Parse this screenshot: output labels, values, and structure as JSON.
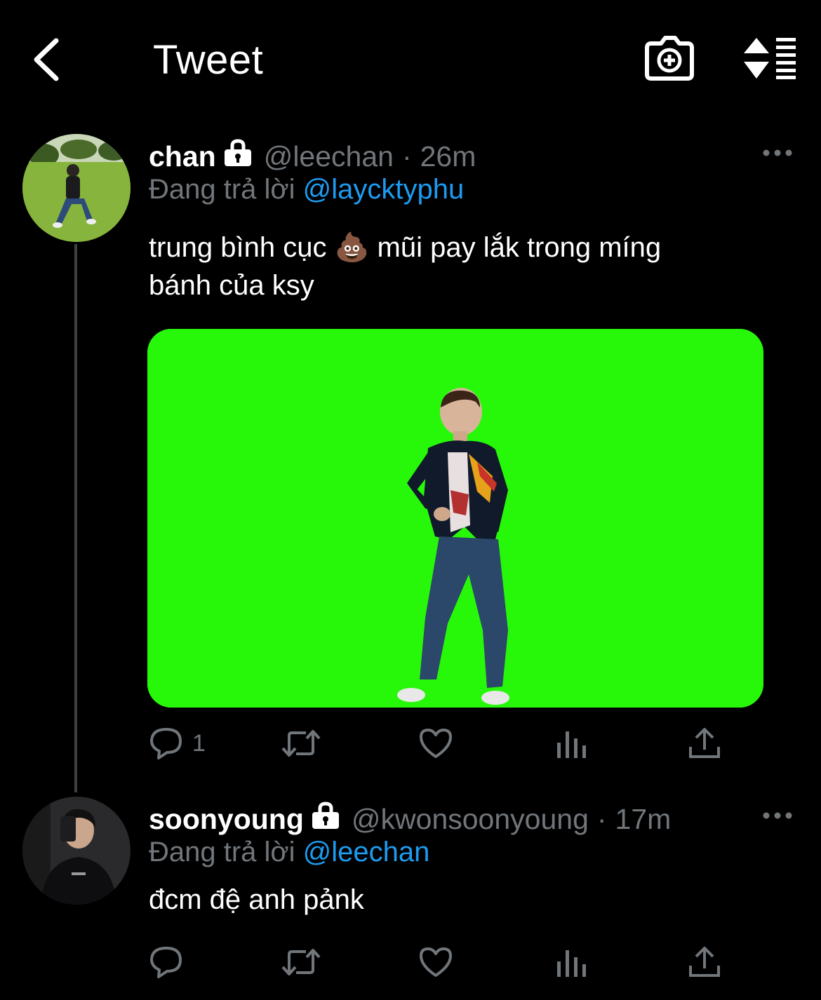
{
  "header": {
    "title": "Tweet",
    "back_icon": "chevron-left-icon",
    "camera_icon": "camera-plus-icon",
    "sort_icon": "sort-icon"
  },
  "tweets": [
    {
      "display_name": "chan",
      "handle": "@leechan",
      "separator": "·",
      "time": "26m",
      "reply_prefix": "Đang trả lời",
      "reply_to": "@laycktyphu",
      "text_line1": "trung bình cục 💩  mũi pay lắk trong míng",
      "text_line2": "bánh của ksy",
      "reply_count": "1"
    },
    {
      "display_name": "soonyoung",
      "handle": "@kwonsoonyoung",
      "separator": "·",
      "time": "17m",
      "reply_prefix": "Đang trả lời",
      "reply_to": "@leechan",
      "text_line1": "đcm đệ anh pảnk",
      "reply_count": ""
    }
  ],
  "colors": {
    "background": "#000000",
    "muted": "#71767b",
    "link": "#1d9bf0",
    "green_screen": "#27f80a"
  }
}
